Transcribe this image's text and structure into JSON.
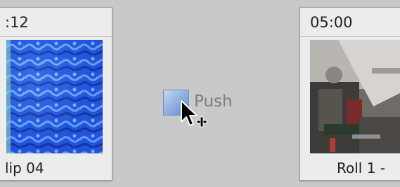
{
  "clips": [
    {
      "timecode": ":12",
      "name": "lip 04",
      "thumbnail": "blue-water-texture"
    },
    {
      "timecode": "05:00",
      "name": "Roll 1 -",
      "thumbnail": "machinery-photo"
    }
  ],
  "transition": {
    "label": "Push",
    "swatch_color": "#8fb2e4"
  },
  "cursor": {
    "icon": "drag-copy-cursor-icon"
  }
}
